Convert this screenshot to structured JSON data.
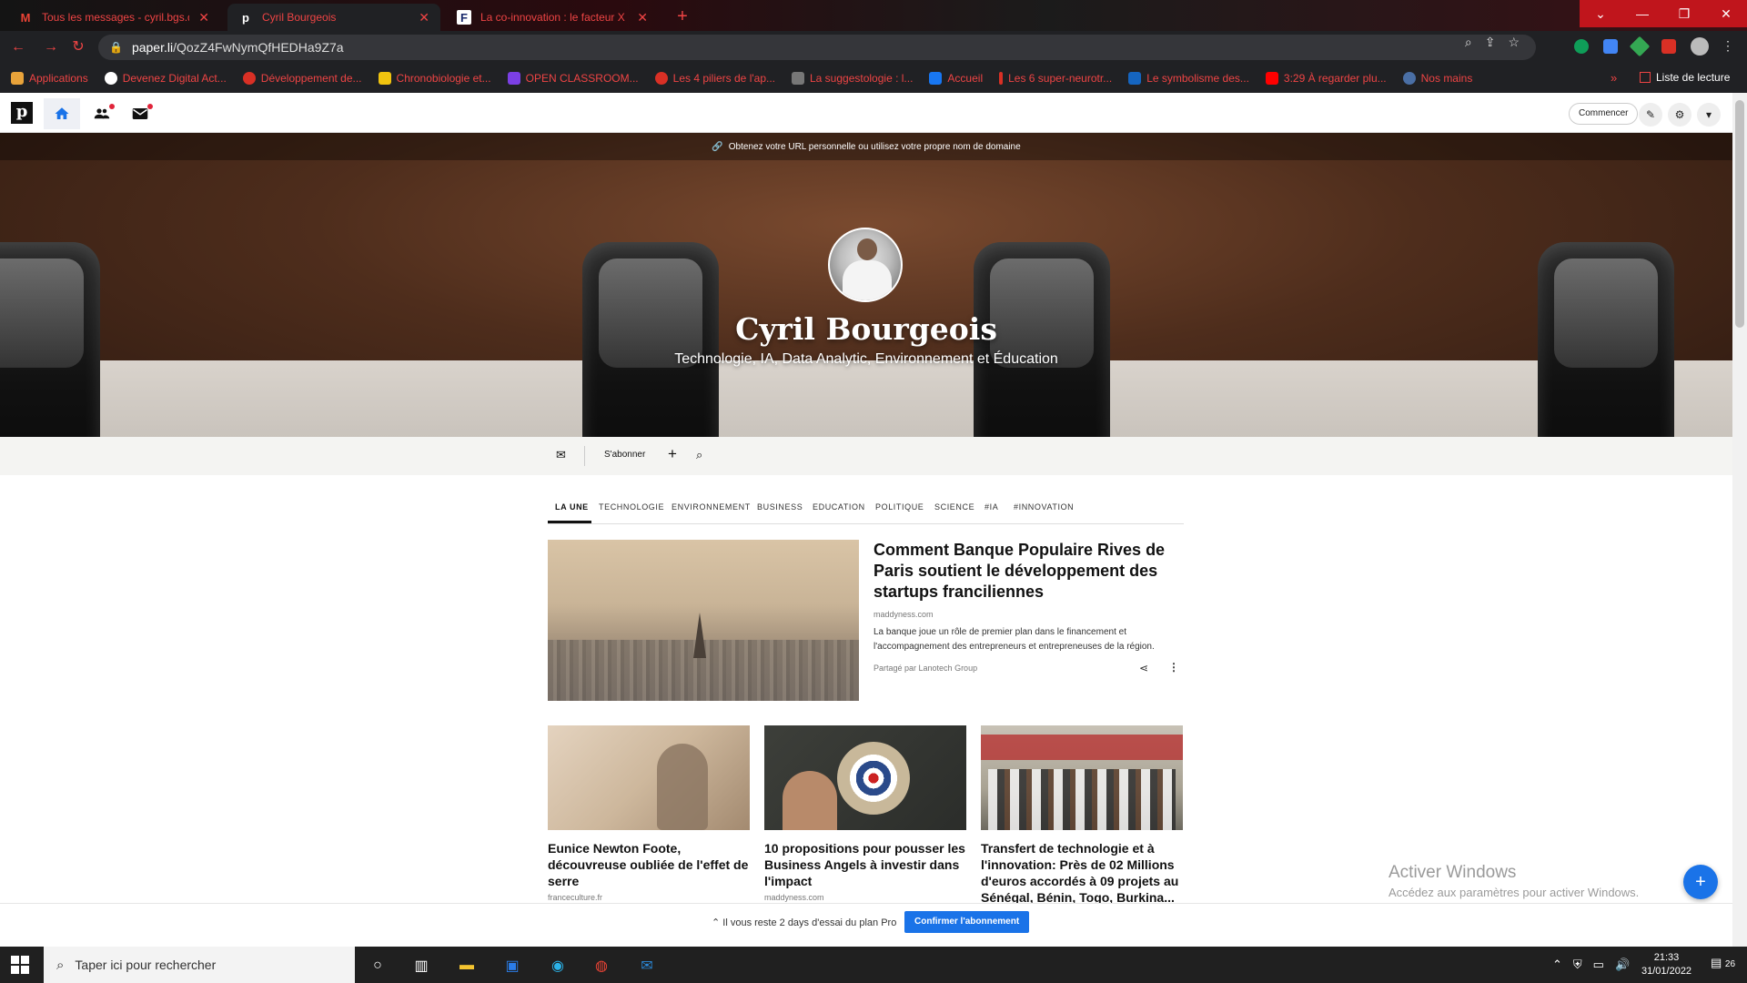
{
  "browser": {
    "tabs": [
      {
        "title": "Tous les messages - cyril.bgs.dev",
        "favicon": "M",
        "active": false
      },
      {
        "title": "Cyril Bourgeois",
        "favicon": "p",
        "active": true
      },
      {
        "title": "La co-innovation : le facteur X de",
        "favicon": "F",
        "active": false
      }
    ],
    "new_tab": "+",
    "url_host": "paper.li",
    "url_path": "/QozZ4FwNymQfHEDHa9Z7a",
    "bookmarks": [
      {
        "label": "Applications",
        "color": "#e8a33a"
      },
      {
        "label": "Devenez Digital Act...",
        "color": "#ffffff"
      },
      {
        "label": "Développement de...",
        "color": "#d93025"
      },
      {
        "label": "Chronobiologie et...",
        "color": "#f1c40f"
      },
      {
        "label": "OPEN CLASSROOM...",
        "color": "#7b3fe4"
      },
      {
        "label": "Les 4 piliers de l'ap...",
        "color": "#d93025"
      },
      {
        "label": "La suggestologie : l...",
        "color": "#777777"
      },
      {
        "label": "Accueil",
        "color": "#1877f2"
      },
      {
        "label": "Les 6 super-neurotr...",
        "color": "#d93025"
      },
      {
        "label": "Le symbolisme des...",
        "color": "#1565c0"
      },
      {
        "label": "3:29 À regarder plu...",
        "color": "#ff0000"
      },
      {
        "label": "Nos mains",
        "color": "#4a6fa5"
      }
    ],
    "bookmarks_more": "»",
    "reading_list": "Liste de lecture"
  },
  "app": {
    "logo": "p",
    "start_button": "Commencer",
    "banner": "Obtenez votre URL personnelle ou utilisez votre propre nom de domaine"
  },
  "profile": {
    "name": "Cyril Bourgeois",
    "tagline": "Technologie, IA, Data Analytic, Environnement et Éducation"
  },
  "subbar": {
    "subscribe": "S'abonner"
  },
  "categories": [
    "LA UNE",
    "TECHNOLOGIE",
    "ENVIRONNEMENT",
    "BUSINESS",
    "EDUCATION",
    "POLITIQUE",
    "SCIENCE",
    "#IA",
    "#INNOVATION"
  ],
  "featured": {
    "title": "Comment Banque Populaire Rives de Paris soutient le développement des startups franciliennes",
    "source": "maddyness.com",
    "description": "La banque joue un rôle de premier plan dans le financement et l'accompagnement des entrepreneurs et entrepreneuses de la région.",
    "shared_by": "Partagé par Lanotech Group"
  },
  "cards": [
    {
      "title": "Eunice Newton Foote, découvreuse oubliée de l'effet de serre",
      "source": "franceculture.fr"
    },
    {
      "title": "10 propositions pour pousser les Business Angels à investir dans l'impact",
      "source": "maddyness.com"
    },
    {
      "title": "Transfert de technologie et à l'innovation: Près de 02 Millions d'euros accordés à 09 projets au Sénégal, Bénin, Togo, Burkina...",
      "source": ""
    }
  ],
  "activate": {
    "title": "Activer Windows",
    "subtitle": "Accédez aux paramètres pour activer Windows."
  },
  "pro": {
    "text": "Il vous reste 2 days d'essai du plan Pro",
    "button": "Confirmer l'abonnement"
  },
  "taskbar": {
    "search_placeholder": "Taper ici pour rechercher",
    "time": "21:33",
    "date": "31/01/2022",
    "notifications": "26"
  },
  "colors": {
    "accent": "#1a73e8",
    "chrome_red": "#e44444"
  }
}
